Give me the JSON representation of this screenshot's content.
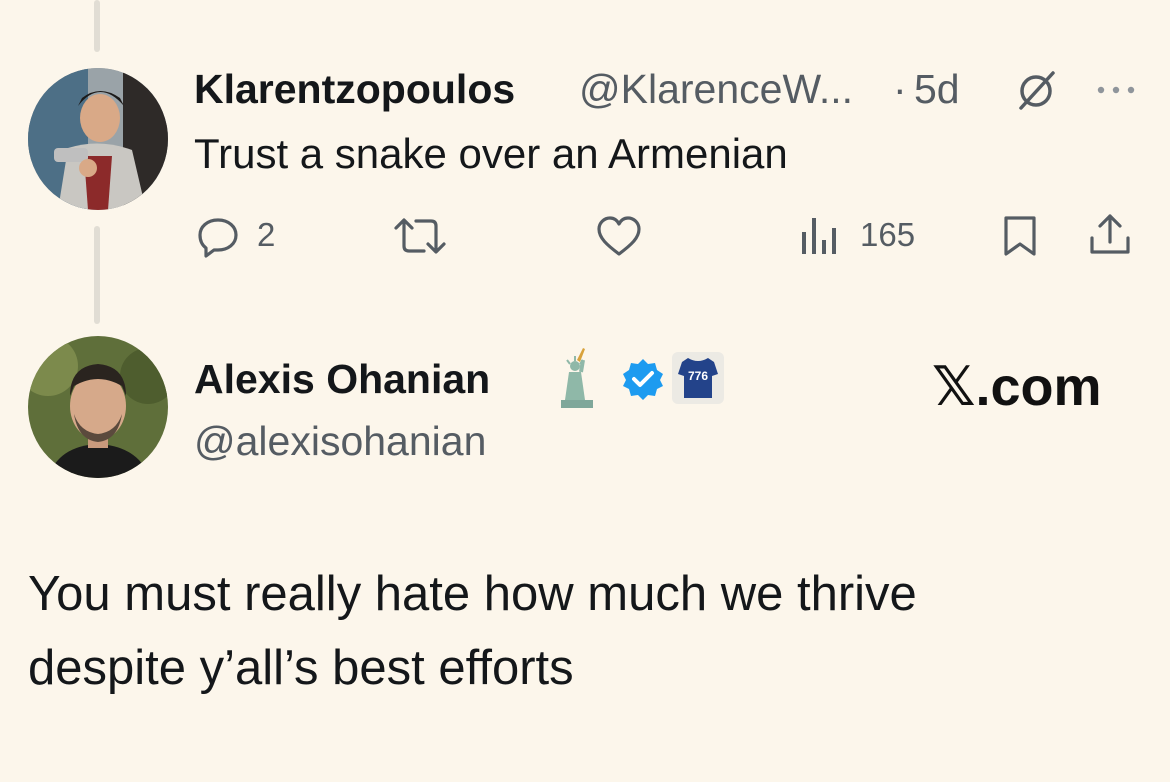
{
  "reply_tweet": {
    "display_name": "Klarentzopoulos",
    "handle": "@KlarenceW...",
    "separator": "·",
    "time": "5d",
    "text": "Trust a snake over an Armenian",
    "reply_count": "2",
    "view_count": "165",
    "icons": [
      "grok-icon",
      "more-icon",
      "reply-icon",
      "repost-icon",
      "like-icon",
      "views-icon",
      "bookmark-icon",
      "share-icon"
    ]
  },
  "quoted_tweet": {
    "display_name": "Alexis Ohanian",
    "handle": "@alexisohanian",
    "text_line1": "You must really hate how much we thrive",
    "text_line2": "despite y’all’s best efforts",
    "badges": [
      "statue-of-liberty-emoji",
      "verified-badge-icon",
      "jersey-emoji"
    ],
    "jersey_number": "776"
  },
  "site": {
    "logo_letter": "𝕏",
    "logo_suffix": ".com"
  },
  "colors": {
    "background": "#FCF6EB",
    "verified": "#1D9BF0",
    "muted": "#555C63",
    "text": "#14171A"
  }
}
